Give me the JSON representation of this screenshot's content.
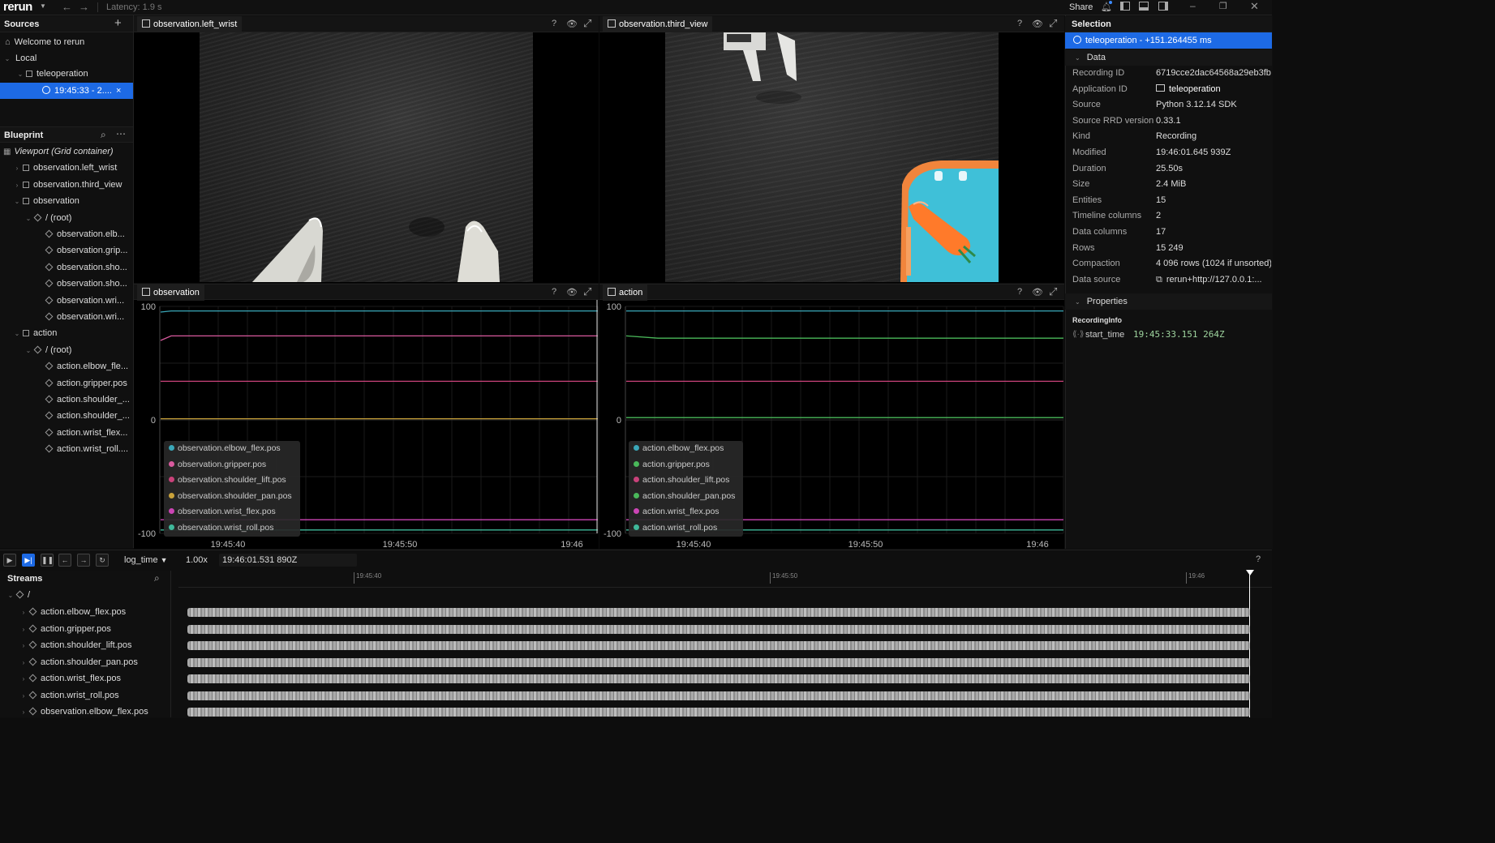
{
  "app": {
    "logo": "rerun",
    "latency": "Latency: 1.9 s",
    "share": "Share"
  },
  "sources": {
    "title": "Sources",
    "add": "+",
    "items": [
      {
        "label": "Welcome to rerun"
      },
      {
        "label": "Local"
      },
      {
        "label": "teleoperation"
      },
      {
        "label": "19:45:33 - 2...."
      }
    ],
    "close": "×"
  },
  "blueprint": {
    "title": "Blueprint",
    "items": [
      "Viewport (Grid container)",
      "observation.left_wrist",
      "observation.third_view",
      "observation",
      "/ (root)",
      "observation.elb...",
      "observation.grip...",
      "observation.sho...",
      "observation.sho...",
      "observation.wri...",
      "observation.wri...",
      "action",
      "/ (root)",
      "action.elbow_fle...",
      "action.gripper.pos",
      "action.shoulder_...",
      "action.shoulder_...",
      "action.wrist_flex...",
      "action.wrist_roll...."
    ]
  },
  "views": {
    "left_wrist": "observation.left_wrist",
    "third_view": "observation.third_view",
    "observation": "observation",
    "action": "action",
    "help": "?",
    "eye": "👁",
    "expand": "⤢"
  },
  "chart_data": [
    {
      "type": "line",
      "ylim": [
        -100,
        100
      ],
      "yticks": [
        "100",
        "0",
        "-100"
      ],
      "xticks": [
        "19:45:40",
        "19:45:50",
        "19:46"
      ],
      "legend_placement": "bottom-left",
      "grid": true,
      "series": [
        {
          "name": "observation.elbow_flex.pos",
          "color": "#3aa7b8",
          "values": [
            95,
            96,
            96,
            96
          ]
        },
        {
          "name": "observation.gripper.pos",
          "color": "#d85a9e",
          "values": [
            70,
            74,
            74,
            74
          ]
        },
        {
          "name": "observation.shoulder_lift.pos",
          "color": "#c9427a",
          "values": [
            34,
            34,
            34,
            34
          ]
        },
        {
          "name": "observation.shoulder_pan.pos",
          "color": "#c9a23a",
          "values": [
            1,
            1,
            1,
            1
          ]
        },
        {
          "name": "observation.wrist_flex.pos",
          "color": "#cc45b5",
          "values": [
            -88,
            -88,
            -88,
            -88
          ]
        },
        {
          "name": "observation.wrist_roll.pos",
          "color": "#3fb89a",
          "values": [
            -97,
            -97,
            -97,
            -97
          ]
        }
      ]
    },
    {
      "type": "line",
      "ylim": [
        -100,
        100
      ],
      "yticks": [
        "100",
        "0",
        "-100"
      ],
      "xticks": [
        "19:45:40",
        "19:45:50",
        "19:46"
      ],
      "legend_placement": "bottom-left",
      "grid": true,
      "series": [
        {
          "name": "action.elbow_flex.pos",
          "color": "#3aa7b8",
          "values": [
            96,
            96,
            96,
            96
          ]
        },
        {
          "name": "action.gripper.pos",
          "color": "#4ab85a",
          "values": [
            74,
            72,
            72,
            72
          ]
        },
        {
          "name": "action.shoulder_lift.pos",
          "color": "#c9427a",
          "values": [
            34,
            34,
            34,
            34
          ]
        },
        {
          "name": "action.shoulder_pan.pos",
          "color": "#4ab85a",
          "values": [
            2,
            2,
            2,
            2
          ]
        },
        {
          "name": "action.wrist_flex.pos",
          "color": "#cc45b5",
          "values": [
            -88,
            -88,
            -88,
            -88
          ]
        },
        {
          "name": "action.wrist_roll.pos",
          "color": "#3fb89a",
          "values": [
            -97,
            -97,
            -97,
            -97
          ]
        }
      ]
    }
  ],
  "selection": {
    "title": "Selection",
    "selected": "teleoperation - +151.264455 ms",
    "data_header": "Data",
    "rows": [
      {
        "k": "Recording ID",
        "v": "6719cce2dac64568a29eb3fb"
      },
      {
        "k": "Application ID",
        "v": "teleoperation"
      },
      {
        "k": "Source",
        "v": "Python 3.12.14 SDK"
      },
      {
        "k": "Source RRD version",
        "v": "0.33.1"
      },
      {
        "k": "Kind",
        "v": "Recording"
      },
      {
        "k": "Modified",
        "v": "19:46:01.645 939Z"
      },
      {
        "k": "Duration",
        "v": "25.50s"
      },
      {
        "k": "Size",
        "v": "2.4 MiB"
      },
      {
        "k": "Entities",
        "v": "15"
      },
      {
        "k": "Timeline columns",
        "v": "2"
      },
      {
        "k": "Data columns",
        "v": "17"
      },
      {
        "k": "Rows",
        "v": "15 249"
      },
      {
        "k": "Compaction",
        "v": "4 096 rows (1024 if unsorted)"
      },
      {
        "k": "Data source",
        "v": "rerun+http://127.0.0.1:..."
      }
    ],
    "properties_header": "Properties",
    "recording_info": "RecordingInfo",
    "start_time_key": "start_time",
    "start_time_val": "19:45:33.151 264Z"
  },
  "timeline": {
    "timeline_name": "log_time",
    "speed": "1.00x",
    "current_time": "19:46:01.531 890Z",
    "help": "?",
    "streams_title": "Streams",
    "root": "/",
    "ticks": [
      "19:45:40",
      "19:45:50",
      "19:46"
    ],
    "streams": [
      "action.elbow_flex.pos",
      "action.gripper.pos",
      "action.shoulder_lift.pos",
      "action.shoulder_pan.pos",
      "action.wrist_flex.pos",
      "action.wrist_roll.pos",
      "observation.elbow_flex.pos"
    ]
  }
}
